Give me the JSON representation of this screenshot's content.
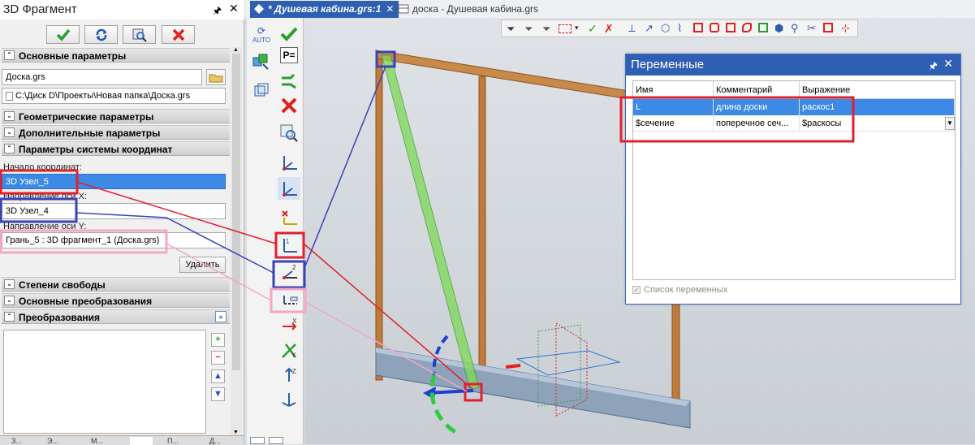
{
  "panel": {
    "title": "3D Фрагмент",
    "buttons": [
      "ok",
      "refresh",
      "preview",
      "cancel"
    ]
  },
  "sections": {
    "basic": "Основные параметры",
    "geometric": "Геометрические параметры",
    "additional": "Дополнительные параметры",
    "coords": "Параметры системы координат",
    "freedom": "Степени свободы",
    "transforms_basic": "Основные преобразования",
    "transforms": "Преобразования"
  },
  "file": {
    "name": "Доска.grs",
    "path": "C:\\Диск D\\Проекты\\Новая папка\\Доска.grs"
  },
  "coords": {
    "origin_label": "Начало координат:",
    "origin_value": "3D Узел_5",
    "x_label": "Направление оси X:",
    "x_value": "3D Узел_4",
    "y_label": "Направление оси Y:",
    "y_value": "Грань_5 : 3D фрагмент_1 (Доска.grs)",
    "delete_label": "Удалить"
  },
  "bottom_tabs": [
    "З...",
    "Э...",
    "М...",
    "",
    "П...",
    "Д..."
  ],
  "tabs": {
    "active": "* Душевая кабина.grs:1",
    "second": "доска - Душевая кабина.grs"
  },
  "toolbar": {
    "auto_label": "AUTO"
  },
  "variables": {
    "title": "Переменные",
    "headers": [
      "Имя",
      "Комментарий",
      "Выражение"
    ],
    "rows": [
      {
        "name": "L",
        "comment": "длина доски",
        "expr": "раскос1"
      },
      {
        "name": "$сечение",
        "comment": "поперечное сеч...",
        "expr": "$раскосы"
      }
    ],
    "checkbox_label": "Список переменных"
  },
  "colors": {
    "accent_blue": "#2f5fb3",
    "selection": "#3c8ae6",
    "annot_red": "#e0212d",
    "annot_blue": "#3a42b8",
    "annot_pink": "#f3a6c6"
  }
}
